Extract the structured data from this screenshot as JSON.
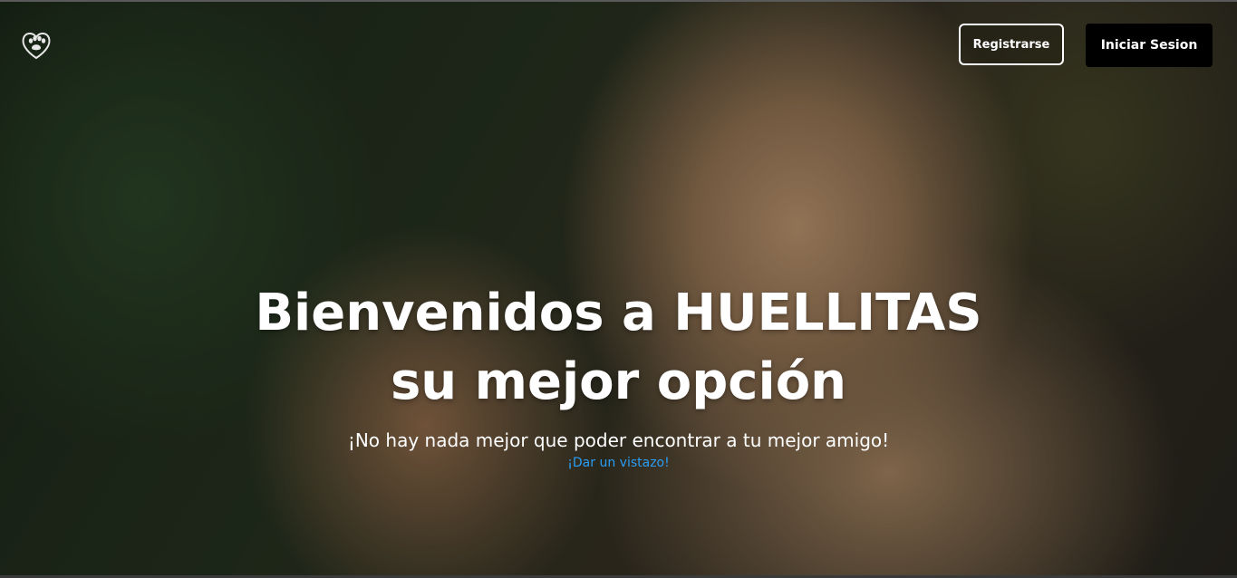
{
  "header": {
    "logo_icon": "paw-heart-icon",
    "register_label": "Registrarse",
    "login_label": "Iniciar Sesion"
  },
  "hero": {
    "title_line1": "Bienvenidos a HUELLITAS",
    "title_line2": "su mejor opción",
    "subtitle": "¡No hay nada mejor que poder encontrar a tu mejor amigo!",
    "link_label": "¡Dar un vistazo!",
    "background_image": "golden-retriever-puppy-and-orange-kitten-photo"
  },
  "colors": {
    "link": "#2a9df4",
    "login_button_bg": "#000000",
    "text": "#ffffff"
  }
}
